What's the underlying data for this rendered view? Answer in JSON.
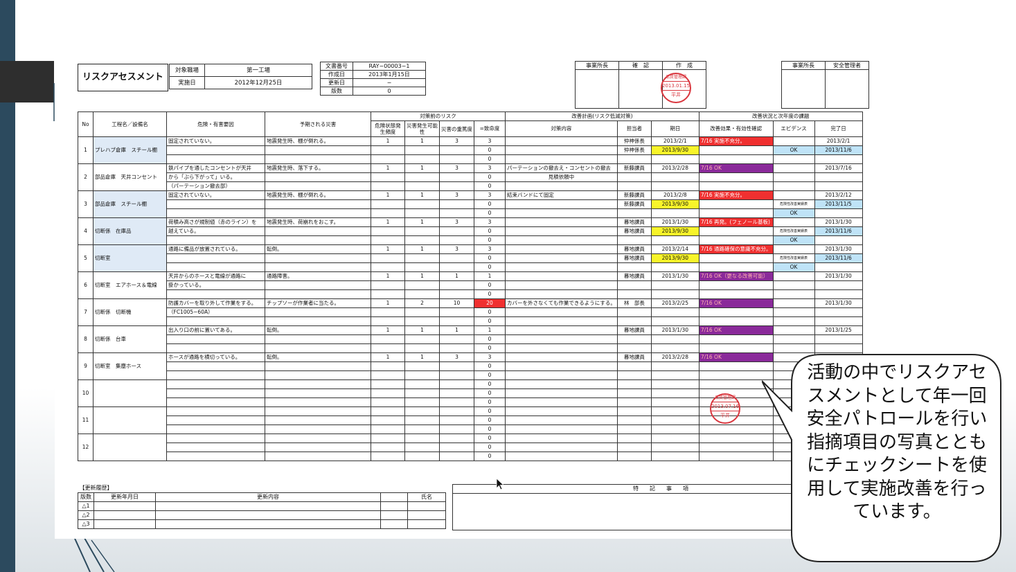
{
  "sheet": {
    "title": "リスクアセスメント",
    "office_label": "対象職場",
    "office_value": "第一工場",
    "date_label": "実施日",
    "date_value": "2012年12月25日",
    "doc_info": [
      {
        "label": "文書番号",
        "value": "RAY−00003−1"
      },
      {
        "label": "作成日",
        "value": "2013年1月15日"
      },
      {
        "label": "更新日",
        "value": "−"
      },
      {
        "label": "版数",
        "value": "0"
      }
    ],
    "approval1": [
      "事業所長",
      "確　認",
      "作　成"
    ],
    "approval2": [
      "事業所長",
      "安全管理者"
    ],
    "stamp1": {
      "line1": "品質管理課",
      "line2": "2013.01.15",
      "line3": "平井"
    },
    "stamp2": {
      "line1": "品質管理課",
      "line2": "2013.07.16",
      "line3": "平井"
    },
    "group_headers": {
      "before": "対策前のリスク",
      "plan": "改善計画(リスク低減対策)",
      "status": "改善状況と次年度の課題"
    },
    "columns": [
      "No",
      "工程名／設備名",
      "危険・有害要因",
      "予期される災害",
      "危険状態発生頻度",
      "災害発生可能性",
      "災害の重篤度",
      "=致命度",
      "対策内容",
      "担当者",
      "期日",
      "改善効果・有効性確認",
      "エビデンス",
      "完了日"
    ],
    "rows": [
      {
        "no": "1",
        "name": "プレハブ倉庫　スチール棚",
        "hazard": [
          "固定されていない。",
          "",
          ""
        ],
        "disaster": [
          "地震発生時、棚が倒れる。",
          "",
          ""
        ],
        "f": "1",
        "p": "1",
        "s": "3",
        "r": [
          "3",
          "0",
          "0"
        ],
        "measure": [
          "",
          "",
          ""
        ],
        "person": [
          "仲神係長",
          "仲神係長",
          ""
        ],
        "due": [
          "2013/2/1",
          "2013/9/30",
          ""
        ],
        "effect": [
          "7/16 実施不充分。",
          "",
          ""
        ],
        "evidence": [
          "",
          "OK",
          ""
        ],
        "done": [
          "2013/2/1",
          "2013/11/6",
          ""
        ]
      },
      {
        "no": "2",
        "name": "部品倉庫　天井コンセント",
        "hazard": [
          "鉄パイプを通したコンセントが天井",
          "から「ぶら下がって」いる。",
          "（パーテーション撤去部）"
        ],
        "disaster": [
          "地震発生時、落下する。",
          "",
          ""
        ],
        "f": "1",
        "p": "1",
        "s": "3",
        "r": [
          "3",
          "0",
          "0"
        ],
        "measure": [
          "パーテーションの撤去え・コンセントの撤去",
          "見積依頼中",
          ""
        ],
        "person": [
          "新藤課員",
          "",
          ""
        ],
        "due": [
          "2013/2/28",
          "",
          ""
        ],
        "effect": [
          "7/16 OK",
          "",
          ""
        ],
        "evidence": [
          "",
          "",
          ""
        ],
        "done": [
          "2013/7/16",
          "",
          ""
        ]
      },
      {
        "no": "3",
        "name": "部品倉庫　スチール棚",
        "hazard": [
          "固定されていない。",
          "",
          ""
        ],
        "disaster": [
          "地震発生時、棚が倒れる。",
          "",
          ""
        ],
        "f": "1",
        "p": "1",
        "s": "3",
        "r": [
          "3",
          "0",
          "0"
        ],
        "measure": [
          "結束バンドにて固定",
          "",
          ""
        ],
        "person": [
          "新藤課員",
          "新藤課員",
          ""
        ],
        "due": [
          "2013/2/8",
          "2013/9/30",
          ""
        ],
        "effect": [
          "7/16 実施不充分。",
          "",
          ""
        ],
        "evidence": [
          "",
          "危険性改善実績表",
          "OK"
        ],
        "done": [
          "2013/2/12",
          "2013/11/5",
          ""
        ]
      },
      {
        "no": "4",
        "name": "切断係　在庫品",
        "hazard": [
          "荷積み高さが規制値（赤のライン）を",
          "越えている。",
          ""
        ],
        "disaster": [
          "地震発生時、荷崩れをおこす。",
          "",
          ""
        ],
        "f": "1",
        "p": "1",
        "s": "3",
        "r": [
          "3",
          "0",
          "0"
        ],
        "measure": [
          "",
          "",
          ""
        ],
        "person": [
          "暮地課員",
          "暮地課員",
          ""
        ],
        "due": [
          "2013/1/30",
          "2013/9/30",
          ""
        ],
        "effect": [
          "7/16 再発。(フェノール基板)",
          "",
          ""
        ],
        "evidence": [
          "",
          "危険性改善実績表",
          "OK"
        ],
        "done": [
          "2013/1/30",
          "2013/11/6",
          ""
        ]
      },
      {
        "no": "5",
        "name": "切断室",
        "hazard": [
          "通路に備品が放置されている。",
          "",
          ""
        ],
        "disaster": [
          "転倒。",
          "",
          ""
        ],
        "f": "1",
        "p": "1",
        "s": "3",
        "r": [
          "3",
          "0",
          "0"
        ],
        "measure": [
          "",
          "",
          ""
        ],
        "person": [
          "暮地課員",
          "暮地課員",
          ""
        ],
        "due": [
          "2013/2/14",
          "2013/9/30",
          ""
        ],
        "effect": [
          "7/16 通路確保の意識不充分。",
          "",
          ""
        ],
        "evidence": [
          "",
          "危険性改善実績表",
          "OK"
        ],
        "done": [
          "2013/1/30",
          "2013/11/6",
          ""
        ]
      },
      {
        "no": "6",
        "name": "切断室　エアホース＆電線",
        "hazard": [
          "天井からのホースと電線が通路に",
          "掛かっている。",
          ""
        ],
        "disaster": [
          "通路障害。",
          "",
          ""
        ],
        "f": "1",
        "p": "1",
        "s": "1",
        "r": [
          "1",
          "0",
          "0"
        ],
        "measure": [
          "",
          "",
          ""
        ],
        "person": [
          "暮地課員",
          "",
          ""
        ],
        "due": [
          "2013/1/30",
          "",
          ""
        ],
        "effect": [
          "7/16 OK（更なる改善可能）",
          "",
          ""
        ],
        "evidence": [
          "",
          "",
          ""
        ],
        "done": [
          "2013/1/30",
          "",
          ""
        ]
      },
      {
        "no": "7",
        "name": "切断係　切断機",
        "hazard": [
          "防護カバーを取り外して作業をする。",
          "（FC1005−60A）",
          ""
        ],
        "disaster": [
          "チップソーが作業者に当たる。",
          "",
          ""
        ],
        "f": "1",
        "p": "2",
        "s": "10",
        "r": [
          "20",
          "0",
          "0"
        ],
        "measure": [
          "カバーを外さなくても作業できるようにする。",
          "",
          ""
        ],
        "person": [
          "林　部長",
          "",
          ""
        ],
        "due": [
          "2013/2/25",
          "",
          ""
        ],
        "effect": [
          "7/16 OK",
          "",
          ""
        ],
        "evidence": [
          "",
          "",
          ""
        ],
        "done": [
          "2013/1/30",
          "",
          ""
        ]
      },
      {
        "no": "8",
        "name": "切断係　台車",
        "hazard": [
          "出入り口の前に置いてある。",
          "",
          ""
        ],
        "disaster": [
          "転倒。",
          "",
          ""
        ],
        "f": "1",
        "p": "1",
        "s": "1",
        "r": [
          "1",
          "0",
          "0"
        ],
        "measure": [
          "",
          "",
          ""
        ],
        "person": [
          "暮地課員",
          "",
          ""
        ],
        "due": [
          "2013/1/30",
          "",
          ""
        ],
        "effect": [
          "7/16 OK",
          "",
          ""
        ],
        "evidence": [
          "",
          "",
          ""
        ],
        "done": [
          "2013/1/25",
          "",
          ""
        ]
      },
      {
        "no": "9",
        "name": "切断室　集塵ホース",
        "hazard": [
          "ホースが通路を横切っている。",
          "",
          ""
        ],
        "disaster": [
          "転倒。",
          "",
          ""
        ],
        "f": "1",
        "p": "1",
        "s": "3",
        "r": [
          "3",
          "0",
          "0"
        ],
        "measure": [
          "",
          "",
          ""
        ],
        "person": [
          "暮地課員",
          "",
          ""
        ],
        "due": [
          "2013/2/28",
          "",
          ""
        ],
        "effect": [
          "7/16 OK",
          "",
          ""
        ],
        "evidence": [
          "",
          "",
          ""
        ],
        "done": [
          "",
          "",
          ""
        ]
      },
      {
        "no": "10",
        "name": "",
        "hazard": [
          "",
          "",
          ""
        ],
        "disaster": [
          "",
          "",
          ""
        ],
        "f": "",
        "p": "",
        "s": "",
        "r": [
          "0",
          "0",
          "0"
        ],
        "measure": [
          "",
          "",
          ""
        ],
        "person": [
          "",
          "",
          ""
        ],
        "due": [
          "",
          "",
          ""
        ],
        "effect": [
          "",
          "",
          ""
        ],
        "evidence": [
          "",
          "",
          ""
        ],
        "done": [
          "",
          "",
          ""
        ]
      },
      {
        "no": "11",
        "name": "",
        "hazard": [
          "",
          "",
          ""
        ],
        "disaster": [
          "",
          "",
          ""
        ],
        "f": "",
        "p": "",
        "s": "",
        "r": [
          "0",
          "0",
          "0"
        ],
        "measure": [
          "",
          "",
          ""
        ],
        "person": [
          "",
          "",
          ""
        ],
        "due": [
          "",
          "",
          ""
        ],
        "effect": [
          "",
          "",
          ""
        ],
        "evidence": [
          "",
          "",
          ""
        ],
        "done": [
          "",
          "",
          ""
        ]
      },
      {
        "no": "12",
        "name": "",
        "hazard": [
          "",
          "",
          ""
        ],
        "disaster": [
          "",
          "",
          ""
        ],
        "f": "",
        "p": "",
        "s": "",
        "r": [
          "0",
          "0",
          "0"
        ],
        "measure": [
          "",
          "",
          ""
        ],
        "person": [
          "",
          "",
          ""
        ],
        "due": [
          "",
          "",
          ""
        ],
        "effect": [
          "",
          "",
          ""
        ],
        "evidence": [
          "",
          "",
          ""
        ],
        "done": [
          "",
          "",
          ""
        ]
      }
    ],
    "history": {
      "title": "【更新履歴】",
      "headers": [
        "版数",
        "更新年月日",
        "更新内容",
        "氏名"
      ],
      "rows": [
        "△1",
        "△2",
        "△3"
      ]
    },
    "notes_header": "特　　記　　事　　項"
  },
  "callout": {
    "text": "活動の中でリスクアセスメントとして年一回安全パトロールを行い指摘項目の写真とともにチェックシートを使用して実施改善を行っています。"
  },
  "colors": {
    "red": "#f03030",
    "yellow": "#f8f42a",
    "purple": "#8a2a9a",
    "blue": "#bfe3f7",
    "left_bar": "#2c4a5e"
  }
}
